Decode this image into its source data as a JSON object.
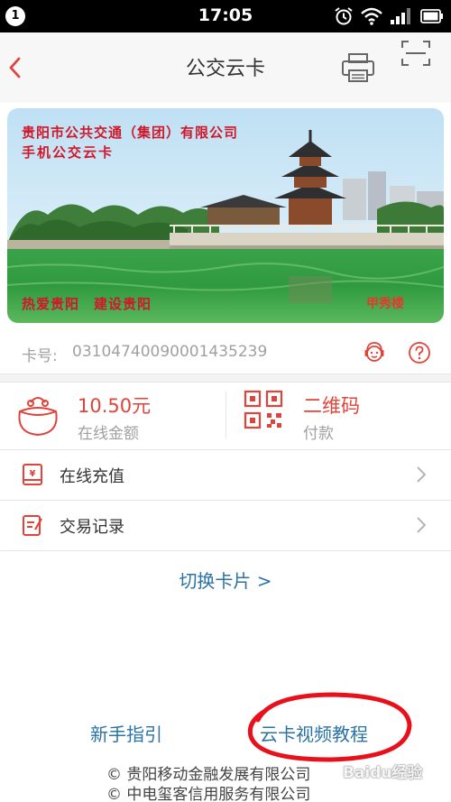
{
  "status_bar": {
    "notification_count": "1",
    "time": "17:05",
    "icons": [
      "alarm-icon",
      "wifi-icon",
      "signal-icon",
      "battery-icon"
    ]
  },
  "nav": {
    "title": "公交云卡",
    "icons": [
      "back-arrow-icon",
      "printer-icon",
      "scan-icon"
    ]
  },
  "card": {
    "company": "贵阳市公共交通（集团）有限公司",
    "name": "手机公交云卡",
    "slogan": "热爱贵阳　建设贵阳",
    "mark": "甲秀楼",
    "scene": "jiaxiu-pavilion-photo"
  },
  "card_number": {
    "label": "卡号:",
    "value": "03104740090001435239",
    "icons": [
      "customer-service-icon",
      "help-icon"
    ]
  },
  "balance": {
    "amount": "10.50元",
    "label": "在线金额",
    "icon": "purse-icon"
  },
  "qr_pay": {
    "title": "二维码",
    "subtitle": "付款",
    "icon": "qr-code-icon"
  },
  "menu": [
    {
      "label": "在线充值",
      "icon": "recharge-icon"
    },
    {
      "label": "交易记录",
      "icon": "record-icon"
    }
  ],
  "switch_card": "切换卡片 >",
  "bottom_links": {
    "guide": "新手指引",
    "tutorial": "云卡视频教程"
  },
  "footer": {
    "line1": "© 贵阳移动金融发展有限公司",
    "line2": "© 中电玺客信用服务有限公司"
  },
  "watermark": "Baidu经验",
  "colors": {
    "accent": "#e0433a",
    "link": "#2c73a5",
    "card_text": "#d0182a",
    "annotation": "#e8101a"
  }
}
